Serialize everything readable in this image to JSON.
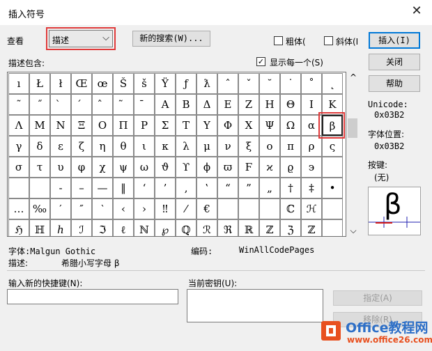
{
  "window": {
    "title": "插入符号",
    "close_glyph": "✕"
  },
  "view": {
    "label": "查看",
    "combo_value": "描述",
    "combo_arrow": "⌵"
  },
  "new_search_button": "新的搜索(W)...",
  "checkbox_bold": {
    "label": "粗体(",
    "checked": false
  },
  "checkbox_italic": {
    "label": "斜体(I",
    "checked": false
  },
  "desc_contains_label": "描述包含:",
  "show_each": {
    "label": "显示每一个(S)",
    "checked": true,
    "mark": "✓"
  },
  "buttons": {
    "insert": "插入(I)",
    "close": "关闭",
    "help": "帮助",
    "assign": "指定(A)",
    "remove": "移除(R)"
  },
  "unicode": {
    "label": "Unicode:",
    "value": "0x03B2"
  },
  "font_position": {
    "label": "字体位置:",
    "value": "0x03B2"
  },
  "key": {
    "label": "按键:",
    "value": "(无)"
  },
  "preview": {
    "char": "β",
    "color_line": "#d01818",
    "color_base": "#2020b0"
  },
  "symbol_grid": {
    "rows": [
      [
        "ı",
        "Ł",
        "ł",
        "Œ",
        "œ",
        "Š",
        "š",
        "Ÿ",
        "ƒ",
        "ƛ",
        "ˆ",
        "ˇ",
        "˘",
        "˙",
        "˚",
        "˛"
      ],
      [
        "˜",
        "˝",
        "̀",
        "́",
        "̂",
        "̃",
        "̄",
        "Α",
        "Β",
        "Δ",
        "Ε",
        "Ζ",
        "Η",
        "Θ",
        "Ι",
        "Κ"
      ],
      [
        "Λ",
        "Μ",
        "Ν",
        "Ξ",
        "Ο",
        "Π",
        "Ρ",
        "Σ",
        "Τ",
        "Υ",
        "Φ",
        "Χ",
        "Ψ",
        "Ω",
        "α",
        "β"
      ],
      [
        "γ",
        "δ",
        "ε",
        "ζ",
        "η",
        "θ",
        "ι",
        "κ",
        "λ",
        "μ",
        "ν",
        "ξ",
        "ο",
        "π",
        "ρ",
        "ς"
      ],
      [
        "σ",
        "τ",
        "υ",
        "φ",
        "χ",
        "ψ",
        "ω",
        "ϑ",
        "ϒ",
        "ϕ",
        "ϖ",
        "Ϝ",
        "ϰ",
        "ϱ",
        "϶",
        ""
      ],
      [
        "",
        "",
        "‑",
        "–",
        "—",
        "‖",
        "‘",
        "’",
        "‚",
        "‛",
        "“",
        "”",
        "„",
        "†",
        "‡",
        "•"
      ],
      [
        "…",
        "‰",
        "′",
        "″",
        "‵",
        "‹",
        "›",
        "‼",
        "⁄",
        "€",
        "",
        "",
        "",
        "ℂ",
        "ℋ",
        ""
      ],
      [
        "ℌ",
        "ℍ",
        "ℎ",
        "ℐ",
        "ℑ",
        "ℓ",
        "ℕ",
        "℘",
        "ℚ",
        "ℛ",
        "ℜ",
        "ℝ",
        "ℤ",
        "ℨ",
        "ℤ",
        ""
      ]
    ],
    "selected": {
      "row": 2,
      "col": 15
    },
    "scroll_up": "^",
    "scroll_down": "⌵"
  },
  "font_info": {
    "label": "字体:",
    "value": "Malgun Gothic",
    "encoding_label": "编码:",
    "encoding_value": "WinAllCodePages"
  },
  "description_info": {
    "label": "描述:",
    "value": "希腊小写字母 β"
  },
  "new_shortcut_label": "输入新的快捷键(N):",
  "current_keys_label": "当前密钥(U):",
  "watermark": {
    "line1": "Office教程网",
    "line2": "www.office26.com",
    "accent": "#e8501f"
  }
}
